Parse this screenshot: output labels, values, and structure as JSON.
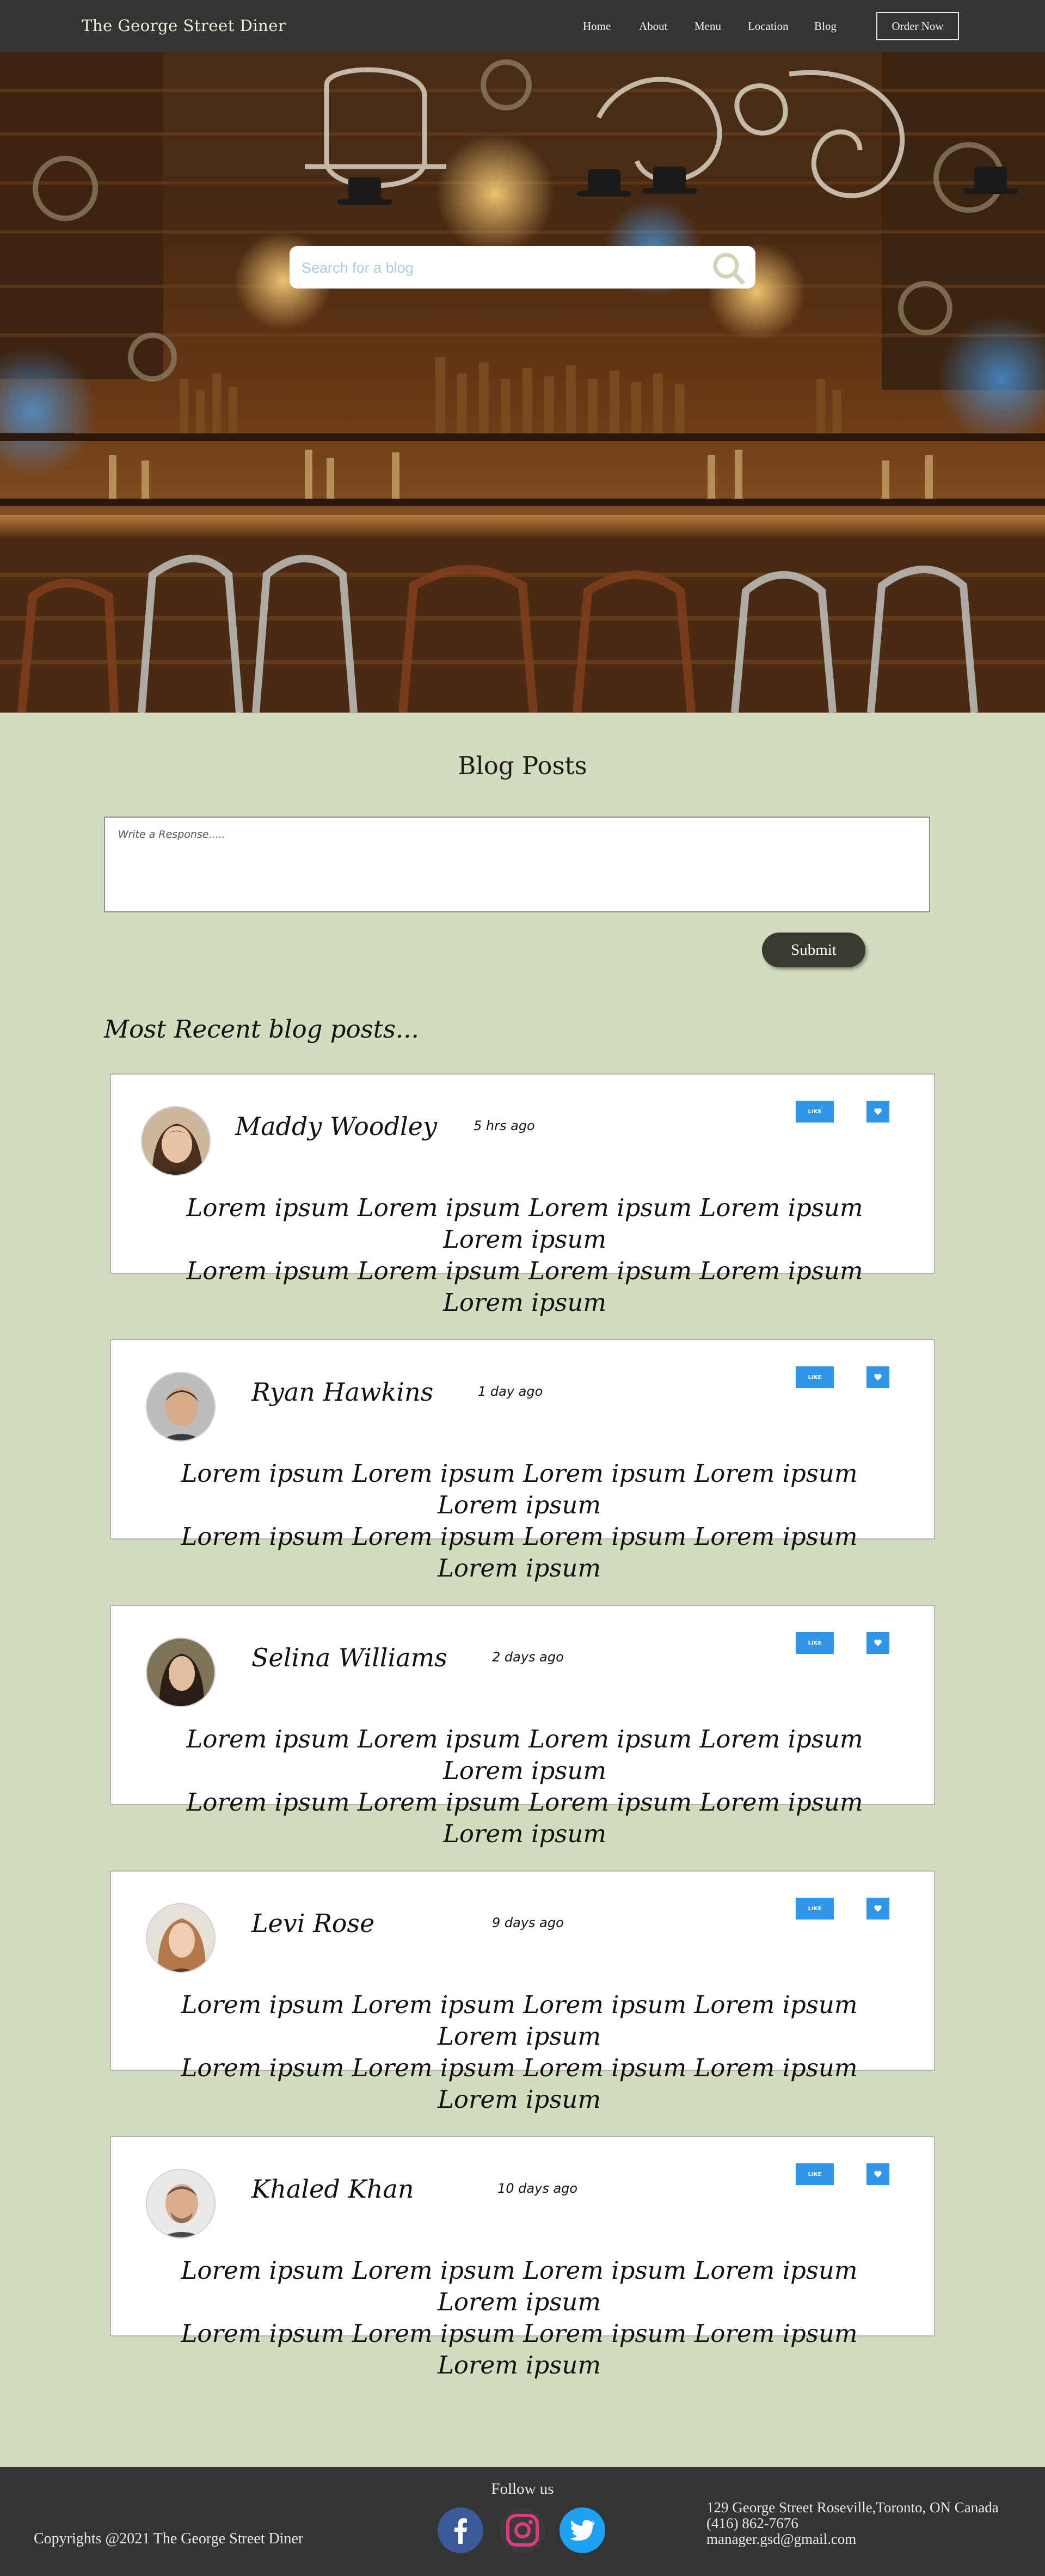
{
  "nav": {
    "brand": "The George Street Diner",
    "links": [
      "Home",
      "About",
      "Menu",
      "Location",
      "Blog"
    ],
    "order_label": "Order Now"
  },
  "hero": {
    "search_placeholder": "Search for a blog",
    "search_icon": "search-icon"
  },
  "main": {
    "title": "Blog Posts",
    "response_placeholder": "Write a Response.....",
    "submit_label": "Submit",
    "recent_title": "Most Recent blog posts..."
  },
  "posts": [
    {
      "author": "Maddy Woodley",
      "time": "5 hrs ago",
      "like_label": "LIKE",
      "heart_icon": "heart-icon",
      "line1": "Lorem ipsum Lorem ipsum Lorem ipsum Lorem ipsum Lorem ipsum",
      "line2": "Lorem ipsum Lorem ipsum Lorem ipsum Lorem ipsum Lorem ipsum"
    },
    {
      "author": "Ryan Hawkins",
      "time": "1 day ago",
      "like_label": "LIKE",
      "heart_icon": "heart-icon",
      "line1": "Lorem ipsum Lorem ipsum Lorem ipsum Lorem ipsum Lorem ipsum",
      "line2": "Lorem ipsum Lorem ipsum Lorem ipsum Lorem ipsum Lorem ipsum"
    },
    {
      "author": "Selina Williams",
      "time": "2 days ago",
      "like_label": "LIKE",
      "heart_icon": "heart-icon",
      "line1": "Lorem ipsum Lorem ipsum Lorem ipsum Lorem ipsum Lorem ipsum",
      "line2": "Lorem ipsum Lorem ipsum Lorem ipsum Lorem ipsum Lorem ipsum"
    },
    {
      "author": "Levi Rose",
      "time": "9 days ago",
      "like_label": "LIKE",
      "heart_icon": "heart-icon",
      "line1": "Lorem ipsum Lorem ipsum Lorem ipsum Lorem ipsum Lorem ipsum",
      "line2": "Lorem ipsum Lorem ipsum Lorem ipsum Lorem ipsum Lorem ipsum"
    },
    {
      "author": "Khaled Khan",
      "time": "10 days ago",
      "like_label": "LIKE",
      "heart_icon": "heart-icon",
      "line1": "Lorem ipsum Lorem ipsum Lorem ipsum Lorem ipsum Lorem ipsum",
      "line2": "Lorem ipsum Lorem ipsum Lorem ipsum Lorem ipsum Lorem ipsum"
    }
  ],
  "footer": {
    "follow_label": "Follow us",
    "copyright": "Copyrights @2021 The George Street Diner",
    "address": "129 George Street Roseville,Toronto, ON Canada",
    "phone": "(416) 862-7676",
    "email": "manager.gsd@gmail.com",
    "social_icons": [
      "facebook-icon",
      "instagram-icon",
      "twitter-icon"
    ]
  },
  "colors": {
    "page_bg": "#d3dcbd",
    "nav_bg": "#343432",
    "accent_blue": "#2f96ea",
    "submit_bg": "#3b3a30"
  }
}
